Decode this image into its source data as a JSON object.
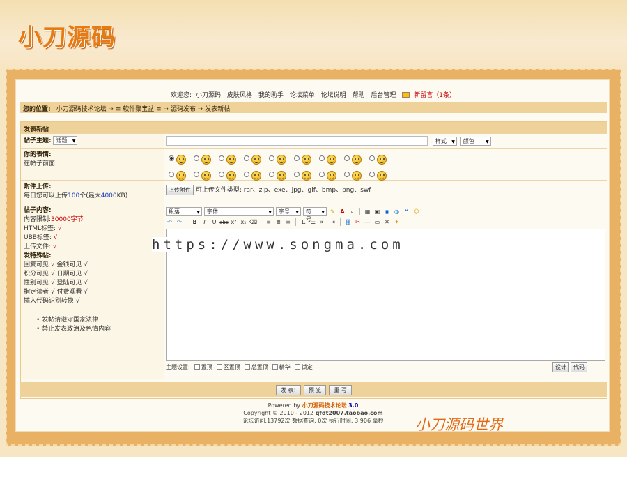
{
  "logo_text": "小刀源码",
  "signature_text": "小刀源码世界",
  "watermark_text": "https://www.songma.com",
  "topnav": {
    "welcome": "欢迎您:",
    "links": [
      "小刀源码",
      "皮肤风格",
      "我的助手",
      "论坛菜单",
      "论坛说明",
      "帮助",
      "后台管理"
    ],
    "new_messages": "新留言（1条）"
  },
  "breadcrumb": {
    "label": "您的位置:",
    "path": "小刀源码技术论坛 → ≡ 软件聚宝盆 ≡ → 源码发布 → 发表新帖"
  },
  "form": {
    "title": "发表新帖",
    "subject": {
      "label": "帖子主题:",
      "topic_select": "话题",
      "style_select": "样式",
      "color_select": "颜色",
      "value": ""
    },
    "emotion": {
      "label": "你的表情:",
      "hint": "在帖子前面",
      "count": 18,
      "selected": 1
    },
    "attachment": {
      "label": "附件上传:",
      "hint_prefix": "每日您可以上传",
      "hint_count": "100",
      "hint_mid": "个(最大",
      "hint_size": "4000",
      "hint_suffix": "KB)",
      "button": "上传附件",
      "types": "可上传文件类型: rar、zip、exe、jpg、gif、bmp、png、swf"
    },
    "content": {
      "label": "帖子内容:",
      "limit_label": "内容限制:",
      "limit_value": "30000字节",
      "html_label": "HTML标签:",
      "ubb_label": "UBB标签:",
      "upload_label": "上传文件:",
      "special_label": "发特殊帖:",
      "special_lines": [
        "回复可见 √ 金钱可见 √",
        "积分可见 √ 日期可见 √",
        "性别可见 √ 登陆可见 √",
        "指定读者 √ 付费观看 √",
        "插入代码识别转换 √"
      ],
      "notes": [
        "发帖请遵守国家法律",
        "禁止发表政治及色情内容"
      ],
      "check": "√"
    },
    "editor": {
      "paragraph_select": "段落",
      "font_select": "字体",
      "size_select": "字号",
      "symbol_select": "符号",
      "design_tab": "设计",
      "code_tab": "代码"
    },
    "options": {
      "label": "主题设置:",
      "items": [
        "置顶",
        "区置顶",
        "总置顶",
        "精华",
        "锁定"
      ]
    },
    "buttons": {
      "submit": "发 表!",
      "preview": "预 览",
      "reset": "重 写"
    }
  },
  "footer": {
    "powered_prefix": "Powered by",
    "brand": "小刀源码技术论坛",
    "version": "3.0",
    "copyright": "Copyright © 2010 - 2012",
    "domain": "qfdt2007.taobao.com",
    "stats": "论坛访问:13792次 数据查询: 0次 执行时间: 3.906 毫秒"
  }
}
